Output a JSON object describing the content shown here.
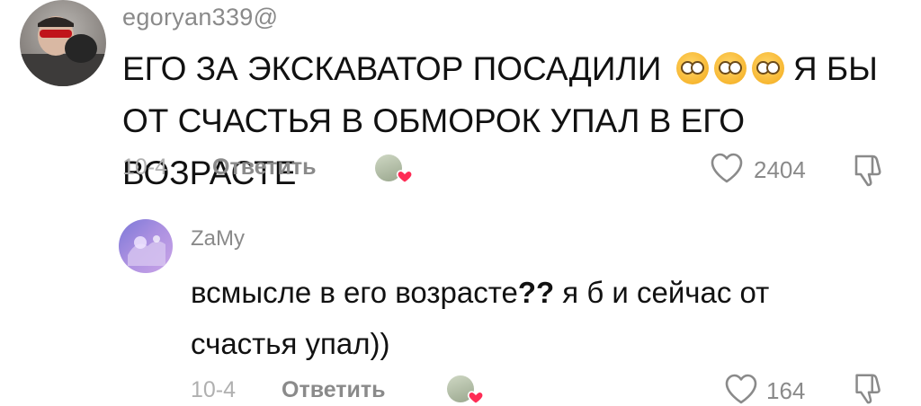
{
  "comments": [
    {
      "username": "egoryan339@",
      "text": "ЕГО ЗА ЭКСКАВАТОР ПОСАДИЛИ",
      "text_after_emoji": "Я БЫ",
      "text_line2": "ОТ СЧАСТЬЯ В ОБМОРОК УПАЛ В ЕГО ВОЗРАСТЕ",
      "emojis": [
        "flushed-face",
        "flushed-face",
        "flushed-face"
      ],
      "date": "10-4",
      "reply_label": "Ответить",
      "likes": "2404"
    },
    {
      "username": "ZaMy",
      "text_part1": "всмысле в его возрасте",
      "text_bold": "??",
      "text_part2": " я б и сейчас от",
      "text_line2": "счастья упал))",
      "date": "10-4",
      "reply_label": "Ответить",
      "likes": "164"
    }
  ],
  "colors": {
    "heart_red": "#fe2c55",
    "muted": "#8a8a8a",
    "date": "#b0b0b0",
    "text": "#111111"
  },
  "icons": [
    "heart-outline-icon",
    "dislike-icon",
    "creator-liked-heart-icon"
  ]
}
